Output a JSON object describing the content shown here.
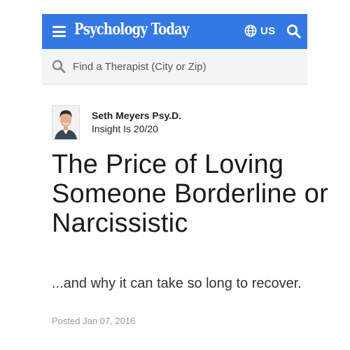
{
  "header": {
    "logo_text": "Psychology Today",
    "region_label": "US",
    "brand_color": "#3478e3",
    "menu_icon": "hamburger-icon",
    "region_icon": "globe-icon",
    "search_icon": "search-icon"
  },
  "therapist_search": {
    "placeholder": "Find a Therapist (City or Zip)",
    "value": "",
    "icon": "search-icon"
  },
  "author": {
    "name": "Seth Meyers Psy.D.",
    "blog": "Insight Is 20/20"
  },
  "article": {
    "title": "The Price of Loving Someone Borderline or Narcissistic",
    "subtitle": "...and why it can take so long to recover.",
    "posted_label": "Posted",
    "posted_date": "Jan 07, 2016"
  }
}
